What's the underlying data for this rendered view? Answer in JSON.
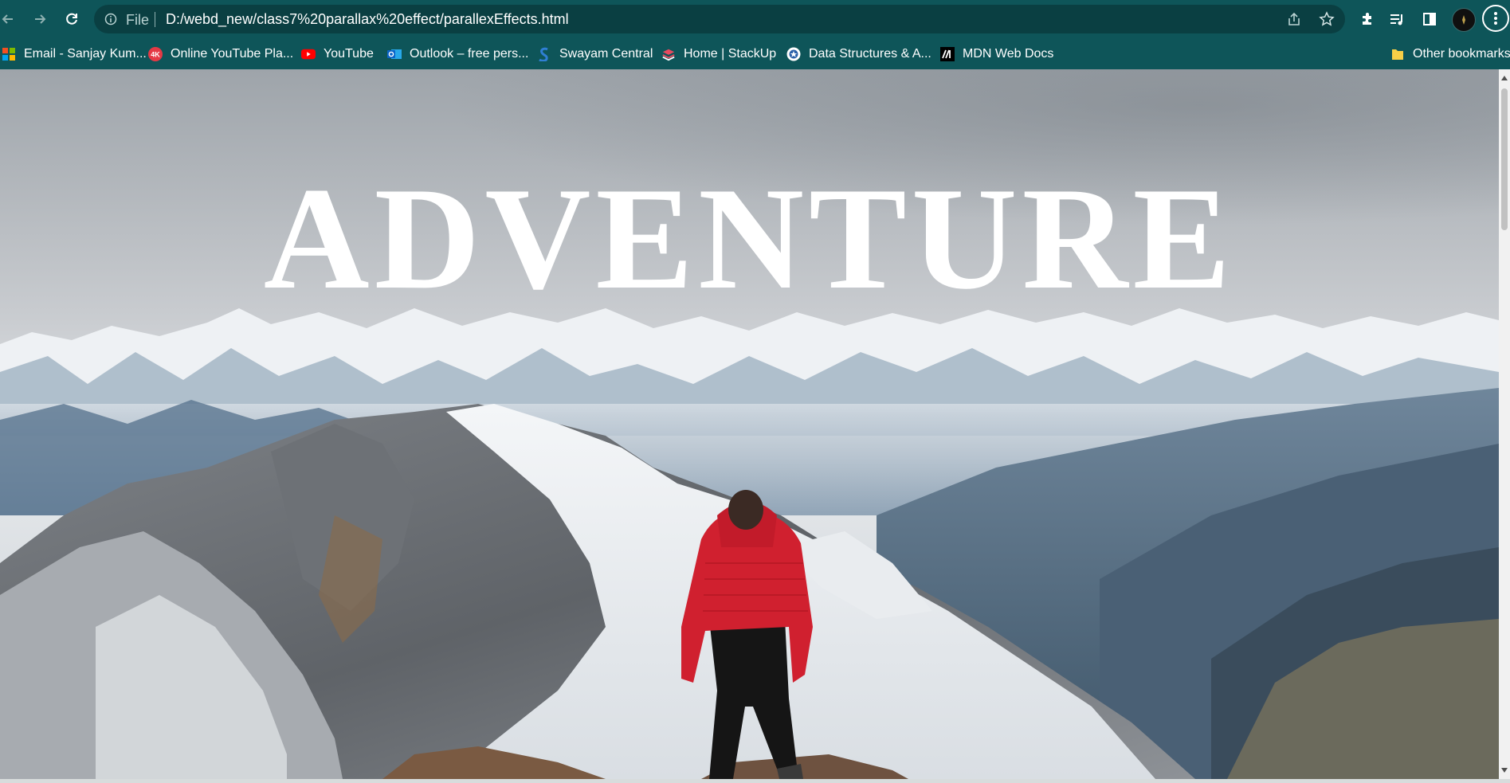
{
  "browser": {
    "url_scheme": "File",
    "url": "D:/webd_new/class7%20parallax%20effect/parallexEffects.html",
    "bookmarks": [
      {
        "label": "Email - Sanjay Kum...",
        "icon": "microsoft-icon"
      },
      {
        "label": "Online YouTube Pla...",
        "icon": "4k-icon"
      },
      {
        "label": "YouTube",
        "icon": "youtube-icon"
      },
      {
        "label": "Outlook – free pers...",
        "icon": "outlook-icon"
      },
      {
        "label": "Swayam Central",
        "icon": "swayam-icon"
      },
      {
        "label": "Home | StackUp",
        "icon": "stackup-icon"
      },
      {
        "label": "Data Structures & A...",
        "icon": "dsa-icon"
      },
      {
        "label": "MDN Web Docs",
        "icon": "mdn-icon"
      }
    ],
    "other_bookmarks": "Other bookmarks",
    "colors": {
      "chrome": "#0e5559",
      "omnibox": "#0a3f42"
    }
  },
  "page": {
    "hero_title": "ADVENTURE"
  }
}
